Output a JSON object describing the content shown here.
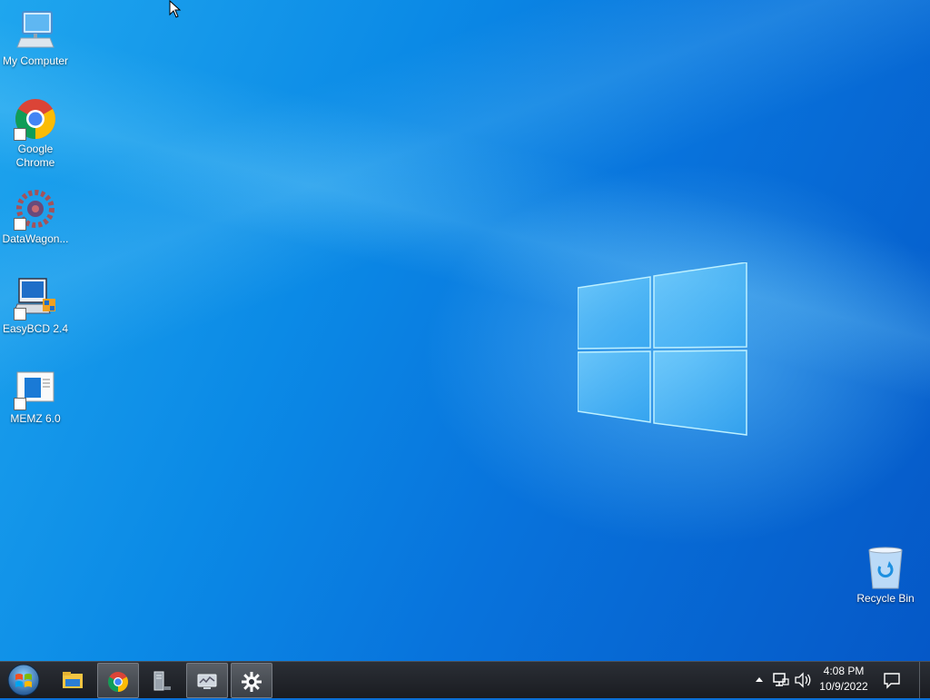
{
  "desktop": {
    "icons": [
      {
        "label": "My Computer",
        "icon": "computer-icon"
      },
      {
        "label": "Google Chrome",
        "icon": "chrome-icon"
      },
      {
        "label": "DataWagon...",
        "icon": "datawagon-icon"
      },
      {
        "label": "EasyBCD 2.4",
        "icon": "easybcd-icon"
      },
      {
        "label": "MEMZ 6.0",
        "icon": "memz-icon"
      },
      {
        "label": "Recycle Bin",
        "icon": "recycle-bin-icon"
      }
    ]
  },
  "taskbar": {
    "start": {
      "icon": "windows-orb-icon"
    },
    "pinned": [
      {
        "icon": "file-explorer-icon",
        "active": false
      },
      {
        "icon": "chrome-icon",
        "active": true
      },
      {
        "icon": "server-icon",
        "active": false
      },
      {
        "icon": "monitor-icon",
        "active": true
      },
      {
        "icon": "settings-gear-icon",
        "active": true
      }
    ],
    "tray": {
      "icons": [
        "show-hidden-icon",
        "network-icon",
        "volume-icon"
      ],
      "time": "4:08 PM",
      "date": "10/9/2022",
      "notification_icon": "action-center-icon"
    }
  },
  "colors": {
    "desktop_blue": "#0a6fd6",
    "taskbar": "#1f2227"
  }
}
